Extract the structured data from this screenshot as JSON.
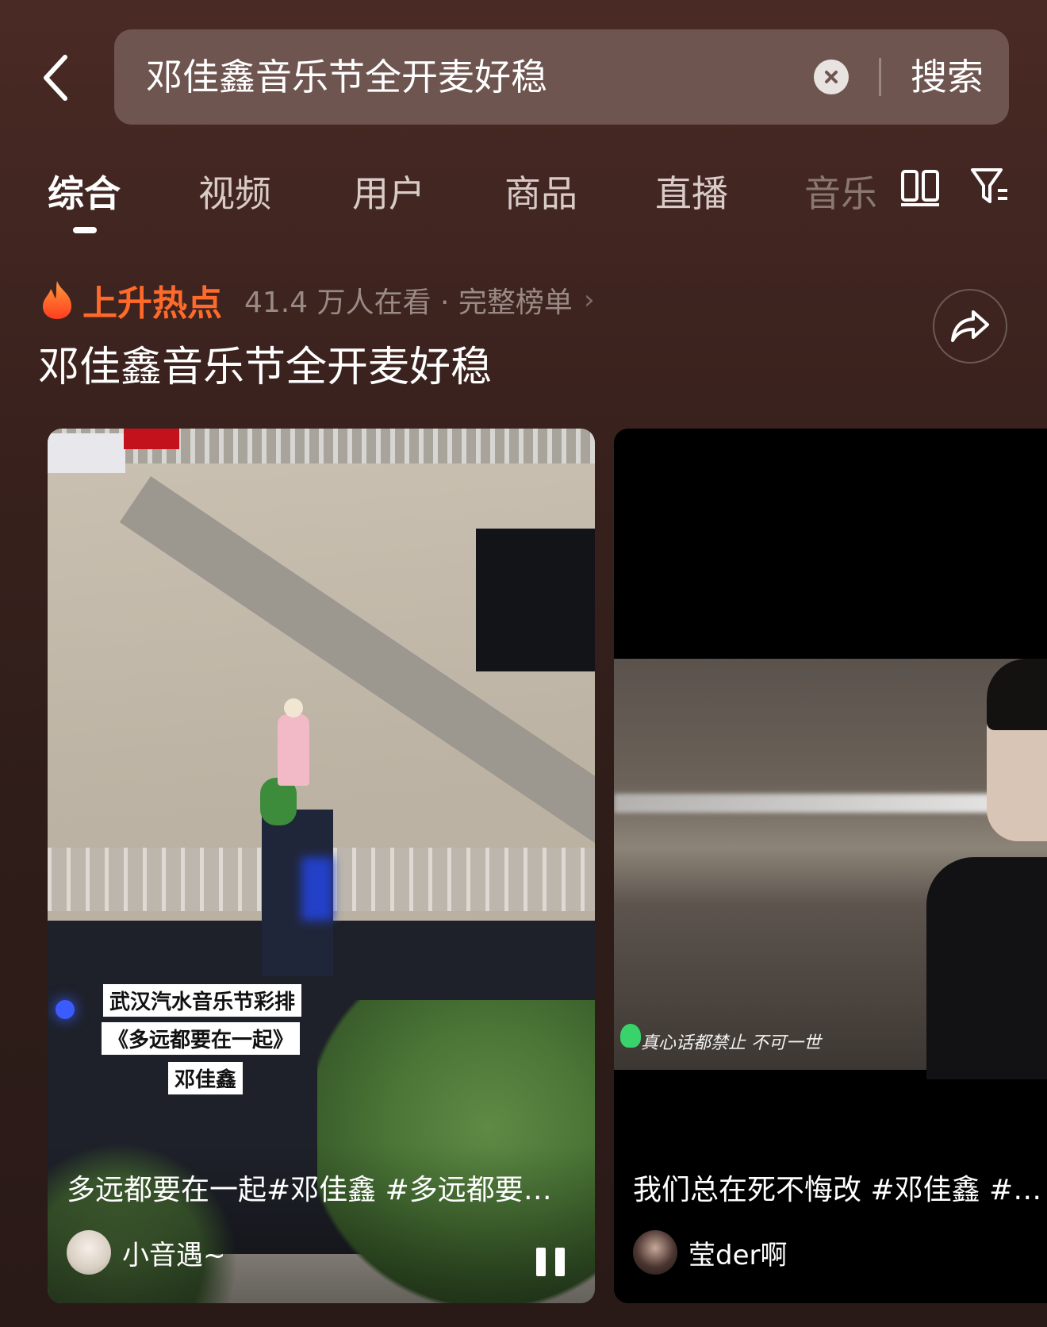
{
  "search": {
    "query": "邓佳鑫音乐节全开麦好稳",
    "submit_label": "搜索"
  },
  "tabs": [
    {
      "label": "综合",
      "active": true
    },
    {
      "label": "视频"
    },
    {
      "label": "用户"
    },
    {
      "label": "商品"
    },
    {
      "label": "直播"
    },
    {
      "label": "音乐"
    }
  ],
  "hot": {
    "label": "上升热点",
    "meta": "41.4 万人在看 · 完整榜单",
    "title": "邓佳鑫音乐节全开麦好稳"
  },
  "cards": [
    {
      "overlay_lines": [
        "武汉汽水音乐节彩排",
        "《多远都要在一起》",
        "邓佳鑫"
      ],
      "caption": "多远都要在一起#邓佳鑫 #多远都要在一起",
      "author": "小音遇~"
    },
    {
      "subtitle": "真心话都禁止 不可一世",
      "caption": "我们总在死不悔改 #邓佳鑫 #汽水音乐节",
      "author": "莹der啊"
    }
  ],
  "colors": {
    "accent": "#ff6a2a",
    "background": "#3a221e"
  },
  "icons": [
    "back-arrow-icon",
    "clear-icon",
    "layout-toggle-icon",
    "filter-icon",
    "flame-icon",
    "chevron-right-icon",
    "share-icon",
    "pause-icon"
  ]
}
